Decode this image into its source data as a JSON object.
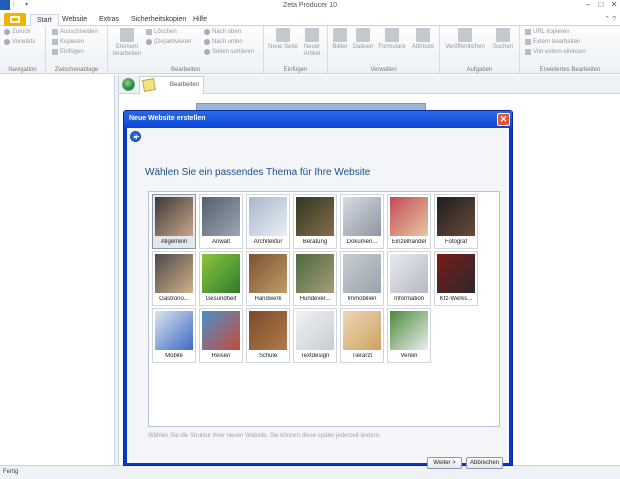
{
  "app": {
    "title": "Zeta Producer 10"
  },
  "tabs": [
    {
      "label": "Start",
      "active": true
    },
    {
      "label": "Website"
    },
    {
      "label": "Extras"
    },
    {
      "label": "Sicherheitskopien"
    },
    {
      "label": "Hilfe"
    }
  ],
  "ribbon": {
    "navigation": {
      "label": "Navigation",
      "back": "Zurück",
      "forward": "Vorwärts"
    },
    "clipboard": {
      "label": "Zwischenablage",
      "cut": "Ausschneiden",
      "copy": "Kopieren",
      "paste": "Einfügen"
    },
    "edit": {
      "label": "Bearbeiten",
      "element": "Element bearbeiten",
      "delete": "Löschen",
      "deactivate": "(De)aktivieren",
      "up": "Nach oben",
      "down": "Nach unten",
      "sort": "Seiten sortieren"
    },
    "insert": {
      "label": "Einfügen",
      "new_page": "Neue Seite",
      "new_article": "Neuer Artikel"
    },
    "manage": {
      "label": "Verwalten",
      "images": "Bilder",
      "files": "Dateien",
      "forms": "Formulare",
      "attributes": "Attribute"
    },
    "tasks": {
      "label": "Aufgaben",
      "publish": "Veröffentlichen",
      "search": "Suchen"
    },
    "advanced": {
      "label": "Erweitertes Bearbeiten",
      "copy_url": "URL kopieren",
      "external_edit": "Extern bearbeiten",
      "external_import": "Von extern einlesen"
    }
  },
  "doc_tab": {
    "label": "Bearbeiten"
  },
  "status": {
    "text": "Fertig"
  },
  "dialog": {
    "title": "Neue Website erstellen",
    "heading": "Wählen Sie ein passendes Thema für Ihre Website",
    "hint": "Wählen Sie die Struktur Ihrer neuen Website. Sie können diese später jederzeit ändern.",
    "next_button": "Weiter >",
    "cancel_button": "Abbrechen",
    "themes": [
      {
        "label": "Allgemein",
        "selected": true
      },
      {
        "label": "Anwalt"
      },
      {
        "label": "Architektur"
      },
      {
        "label": "Beratung"
      },
      {
        "label": "Dokumen..."
      },
      {
        "label": "Einzelhandel"
      },
      {
        "label": "Fotograf"
      },
      {
        "label": "Gastrono..."
      },
      {
        "label": "Gesundheit"
      },
      {
        "label": "Handwerk"
      },
      {
        "label": "Hundever..."
      },
      {
        "label": "Immobilien"
      },
      {
        "label": "Information"
      },
      {
        "label": "Kfz-Werks..."
      },
      {
        "label": "Mobile"
      },
      {
        "label": "Reisen"
      },
      {
        "label": "Schule"
      },
      {
        "label": "Textdesign"
      },
      {
        "label": "Tierarzt"
      },
      {
        "label": "Verein"
      }
    ]
  }
}
